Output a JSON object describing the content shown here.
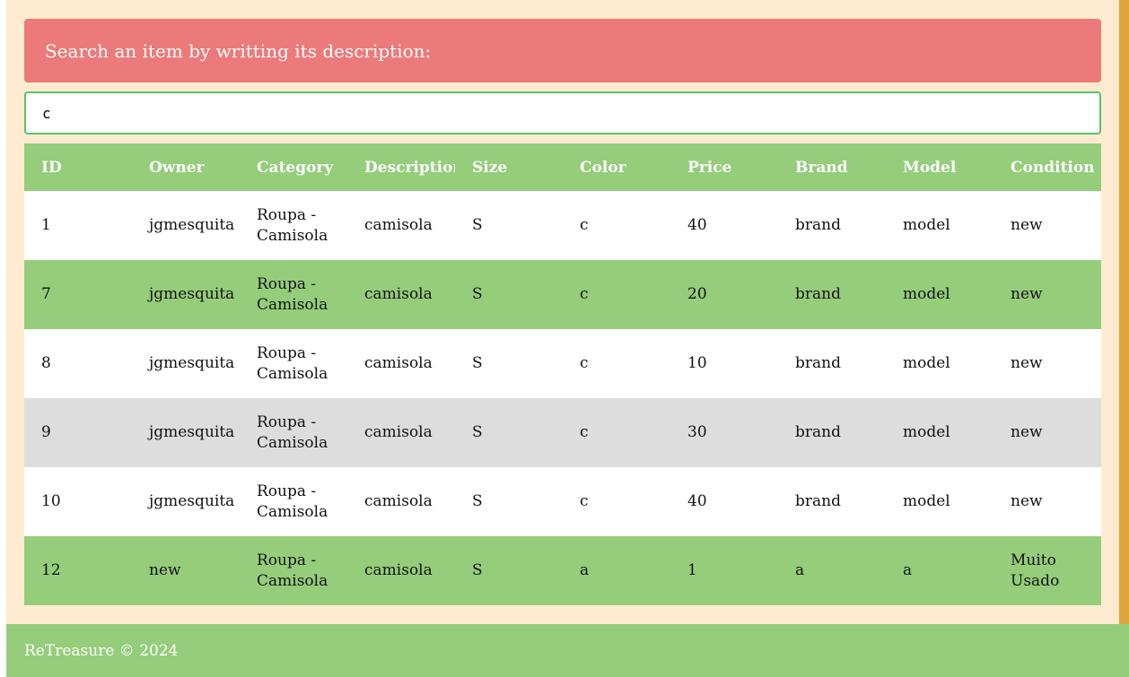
{
  "search": {
    "prompt": "Search an item by writting its description:",
    "value": "c"
  },
  "table": {
    "headers": [
      "ID",
      "Owner",
      "Category",
      "Description",
      "Size",
      "Color",
      "Price",
      "Brand",
      "Model",
      "Condition"
    ],
    "rows": [
      {
        "id": "1",
        "owner": "jgmesquita",
        "category": "Roupa - Camisola",
        "description": "camisola",
        "size": "S",
        "color": "c",
        "price": "40",
        "brand": "brand",
        "model": "model",
        "condition": "new"
      },
      {
        "id": "7",
        "owner": "jgmesquita",
        "category": "Roupa - Camisola",
        "description": "camisola",
        "size": "S",
        "color": "c",
        "price": "20",
        "brand": "brand",
        "model": "model",
        "condition": "new"
      },
      {
        "id": "8",
        "owner": "jgmesquita",
        "category": "Roupa - Camisola",
        "description": "camisola",
        "size": "S",
        "color": "c",
        "price": "10",
        "brand": "brand",
        "model": "model",
        "condition": "new"
      },
      {
        "id": "9",
        "owner": "jgmesquita",
        "category": "Roupa - Camisola",
        "description": "camisola",
        "size": "S",
        "color": "c",
        "price": "30",
        "brand": "brand",
        "model": "model",
        "condition": "new"
      },
      {
        "id": "10",
        "owner": "jgmesquita",
        "category": "Roupa - Camisola",
        "description": "camisola",
        "size": "S",
        "color": "c",
        "price": "40",
        "brand": "brand",
        "model": "model",
        "condition": "new"
      },
      {
        "id": "12",
        "owner": "new",
        "category": "Roupa - Camisola",
        "description": "camisola",
        "size": "S",
        "color": "a",
        "price": "1",
        "brand": "a",
        "model": "a",
        "condition": "Muito Usado"
      }
    ]
  },
  "footer": {
    "text": "ReTreasure © 2024"
  },
  "colors": {
    "page_background": "#ffecd0",
    "search_header": "#ec7a7a",
    "accent_green": "#95cd7b",
    "input_border": "#5cc16a",
    "hover_row": "#dddddd",
    "side_strip": "#e0a43d"
  }
}
